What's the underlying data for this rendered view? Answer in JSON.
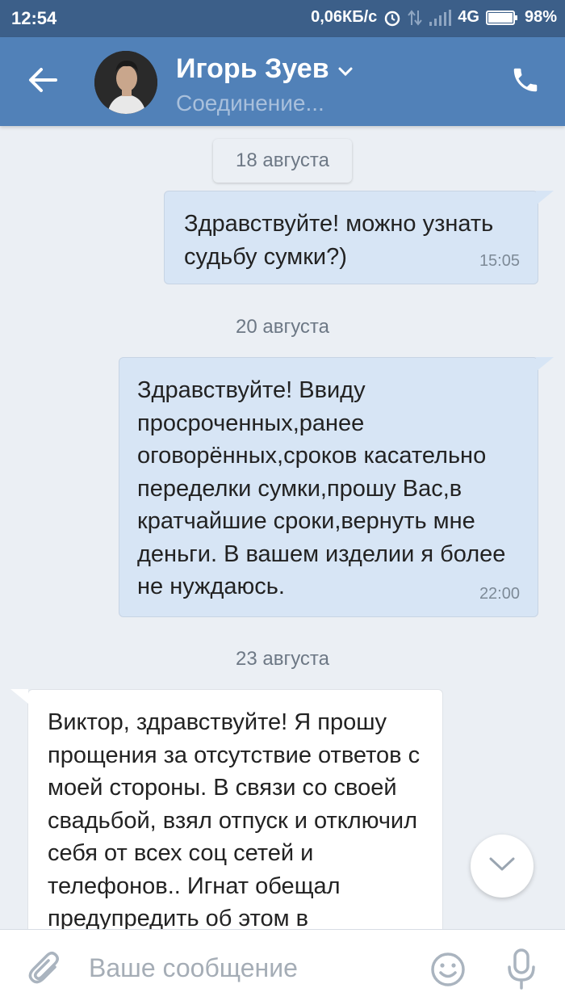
{
  "status_bar": {
    "time": "12:54",
    "speed": "0,06КБ/с",
    "network": "4G",
    "battery": "98%"
  },
  "header": {
    "contact_name": "Игорь Зуев",
    "contact_status": "Соединение..."
  },
  "messages": [
    {
      "date": "18 августа",
      "direction": "out",
      "text": "Здравствуйте! можно узнать судьбу сумки?)",
      "time": "15:05"
    },
    {
      "date": "20 августа",
      "direction": "out",
      "text": "Здравствуйте! Ввиду просроченных,ранее оговорённых,сроков касательно переделки сумки,прошу Вас,в кратчайшие сроки,вернуть мне деньги. В вашем изделии я более не нуждаюсь.",
      "time": "22:00"
    },
    {
      "date": "23 августа",
      "direction": "in",
      "text": "Виктор, здравствуйте! Я прошу прощения за отсутствие ответов с моей стороны. В связи со своей свадьбой, взял отпуск и отключил себя от всех соц сетей и телефонов.. Игнат обещал предупредить об этом в"
    }
  ],
  "composer": {
    "placeholder": "Ваше сообщение"
  },
  "colors": {
    "header_bg": "#5181b8",
    "status_bar_bg": "#3c5f89",
    "chat_bg": "#ebeff4",
    "outgoing_bubble": "#d7e5f5",
    "incoming_bubble": "#ffffff",
    "accent_icon": "#aab4bf"
  },
  "icons": {
    "back": "arrow-left-icon",
    "dropdown": "chevron-down-icon",
    "call": "phone-icon",
    "scroll_down": "chevron-down-icon",
    "attach": "paperclip-icon",
    "emoji": "smiley-icon",
    "mic": "microphone-icon"
  }
}
